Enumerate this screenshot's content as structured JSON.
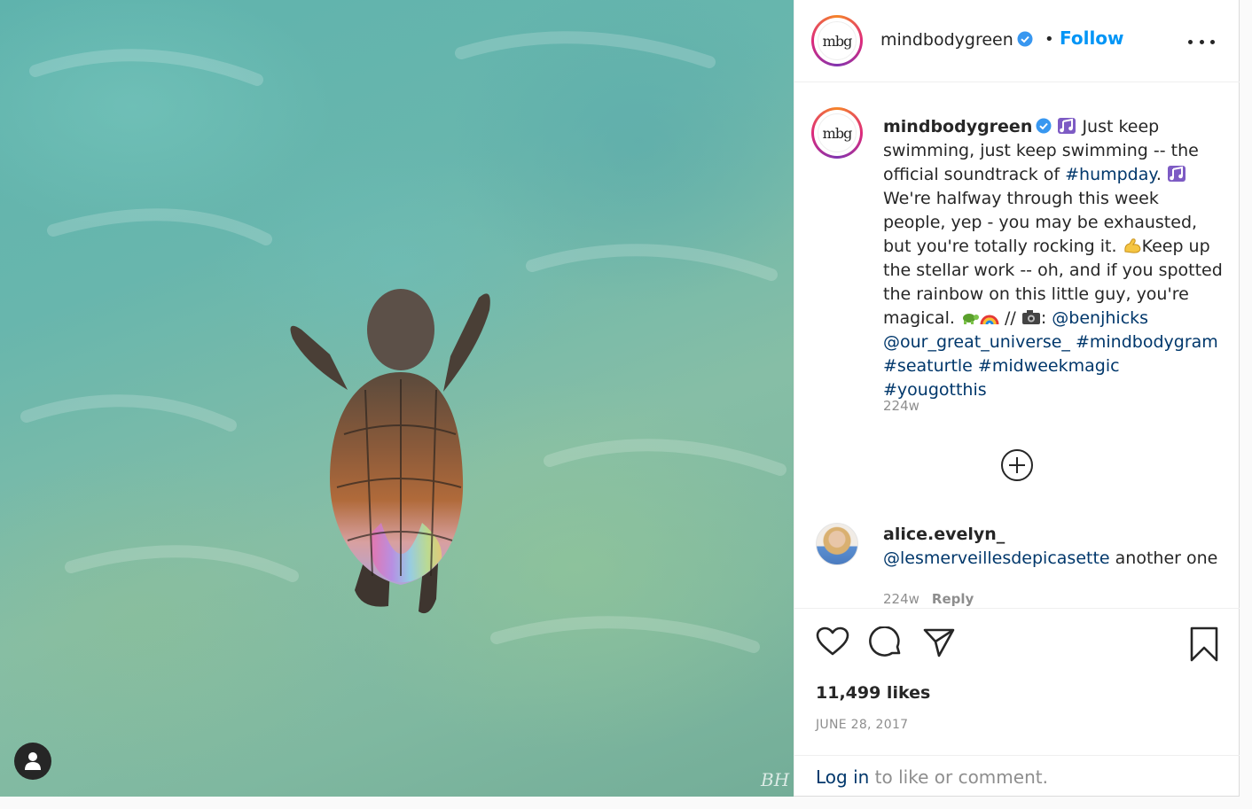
{
  "post": {
    "author": "mindbodygreen",
    "avatar_text": "mbg",
    "follow_label": "Follow",
    "separator": "•",
    "caption": {
      "username": "mindbodygreen",
      "t1": " Just keep swimming, just keep swimming -- the official soundtrack of ",
      "tag_humpday": "#humpday",
      "t2": ". ",
      "t3": " We're halfway through this week people, yep - you may be exhausted, but you're totally rocking it. ",
      "t4": "Keep up the stellar work -- oh, and if you spotted the rainbow on this little guy, you're magical. ",
      "t5": " // ",
      "t6": ": ",
      "mention_benjhicks": "@benjhicks",
      "mention_universe": "@our_great_universe_",
      "tag_mindbodygram": "#mindbodygram",
      "tag_seaturtle": "#seaturtle",
      "tag_midweekmagic": "#midweekmagic",
      "tag_yougotthis": "#yougotthis"
    },
    "caption_time": "224w",
    "comments": [
      {
        "username": "alice.evelyn_",
        "mention": "@lesmerveillesdepicasette",
        "text": "another one",
        "time": "224w",
        "reply_label": "Reply"
      }
    ],
    "likes": "11,499 likes",
    "date": "JUNE 28, 2017",
    "login_link": "Log in",
    "login_suffix": " to like or comment.",
    "watermark": "BH"
  },
  "icons": {
    "verified": "verified-badge-icon",
    "music": "musical-notes-emoji",
    "muscle": "flexed-biceps-emoji",
    "turtle": "turtle-emoji",
    "rainbow": "rainbow-emoji",
    "camera": "camera-emoji"
  },
  "colors": {
    "link_blue": "#0095f6",
    "mention_blue": "#00376b",
    "verified_blue": "#3897f0",
    "muted": "#8e8e8e"
  }
}
